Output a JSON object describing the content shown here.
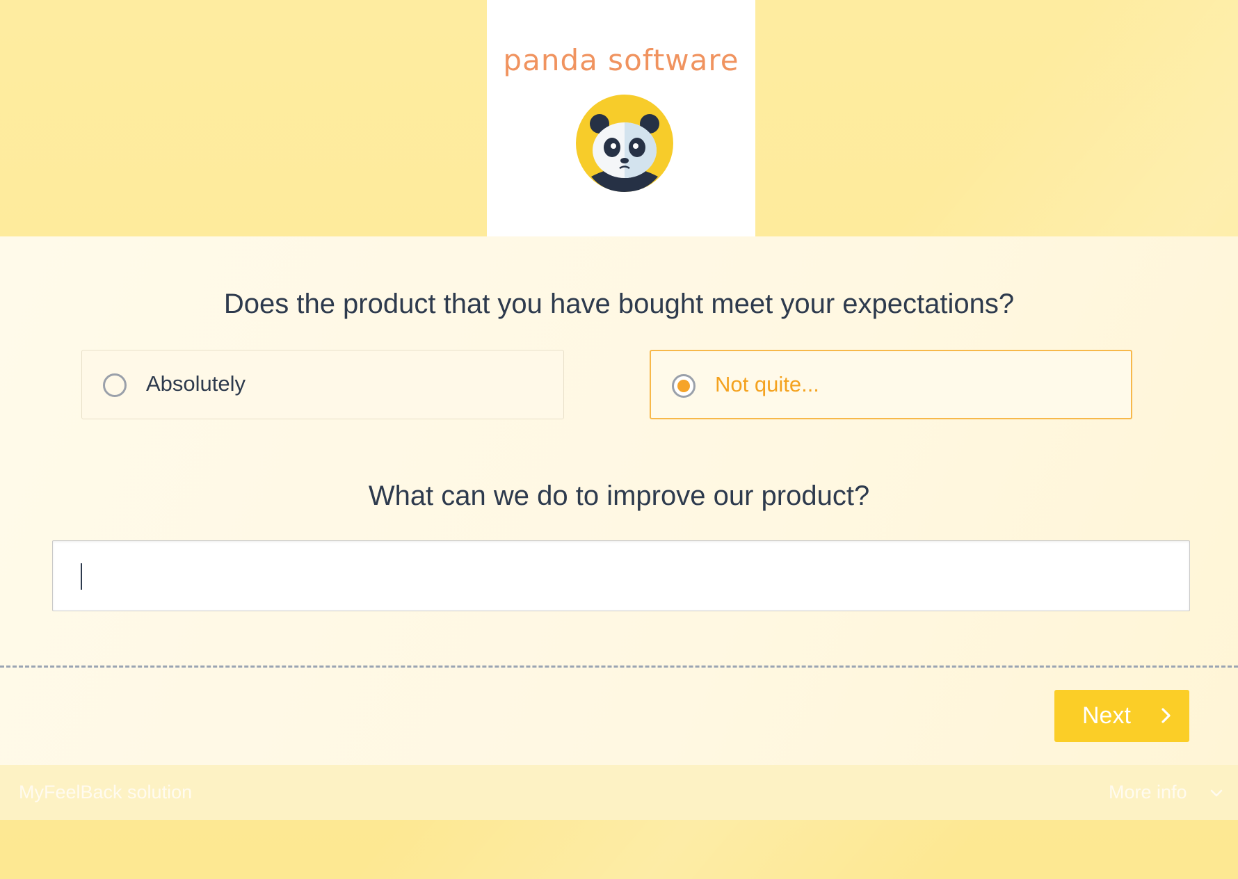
{
  "logo": {
    "brand_text": "panda software",
    "icon": "panda-mascot-icon"
  },
  "survey": {
    "question1": "Does the product that you have bought meet your expectations?",
    "options": [
      {
        "label": "Absolutely",
        "selected": false
      },
      {
        "label": "Not quite...",
        "selected": true
      }
    ],
    "question2": "What can we do to improve our product?",
    "answer_value": ""
  },
  "navigation": {
    "next_label": "Next",
    "next_icon": "chevron-right-icon"
  },
  "footer": {
    "brand": "MyFeelBack solution",
    "more_info": "More info",
    "more_info_icon": "chevron-down-icon"
  },
  "colors": {
    "background": "#fde98f",
    "accent": "#f6a429",
    "button": "#fbce27",
    "text": "#2d3a4d",
    "logo_text": "#f0935f"
  }
}
